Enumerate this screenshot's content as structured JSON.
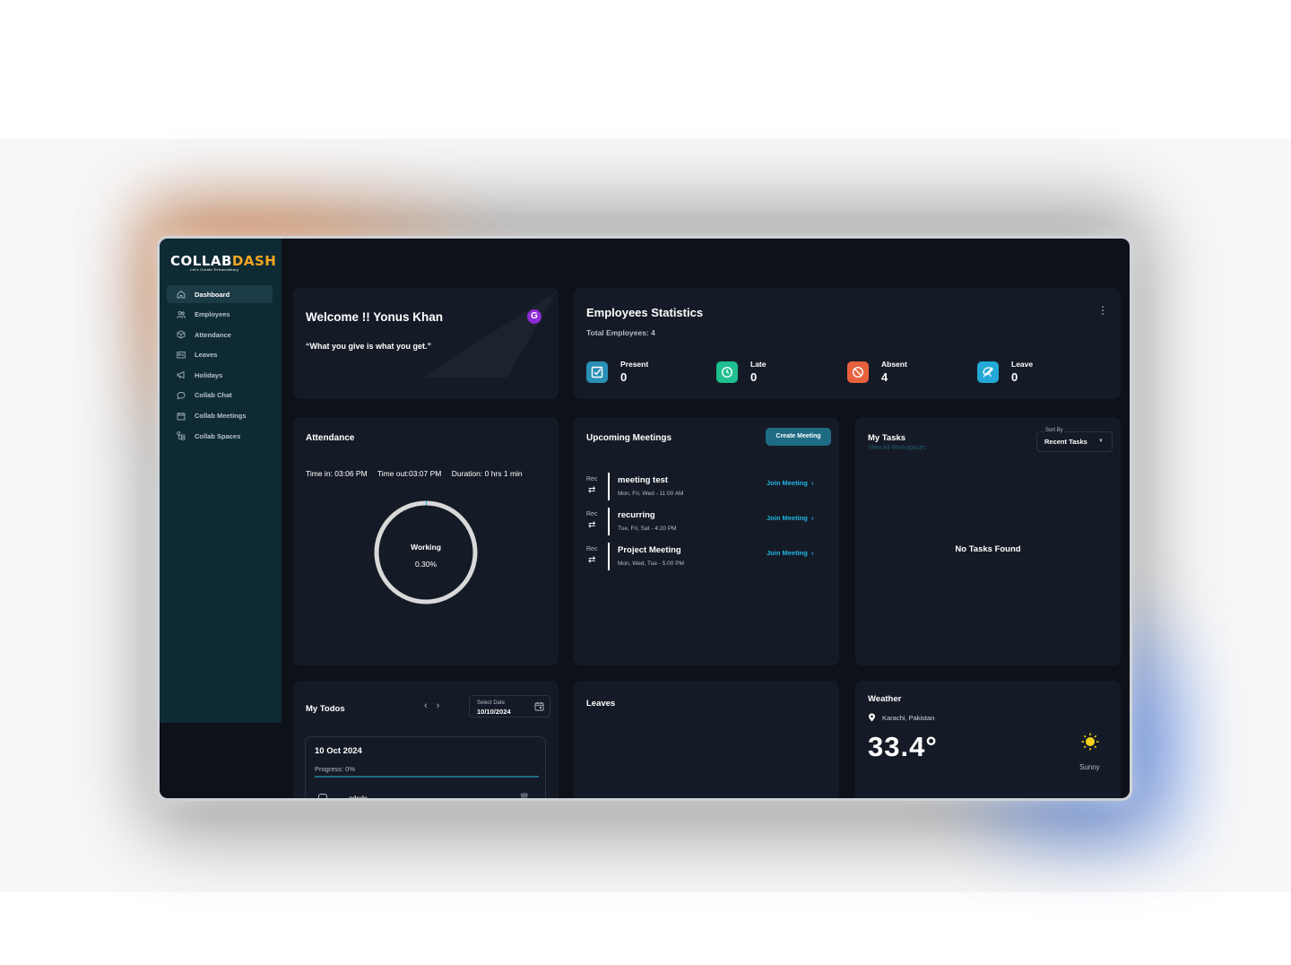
{
  "brand": {
    "name_part1": "COLLAB",
    "name_part2": "DASH",
    "tagline": "Let's Create Extraordinary",
    "accent_color": "#f5a623"
  },
  "sidebar": {
    "items": [
      {
        "label": "Dashboard",
        "icon": "home-icon",
        "active": true
      },
      {
        "label": "Employees",
        "icon": "users-icon"
      },
      {
        "label": "Attendance",
        "icon": "cube-icon"
      },
      {
        "label": "Leaves",
        "icon": "id-card-icon"
      },
      {
        "label": "Holidays",
        "icon": "megaphone-icon"
      },
      {
        "label": "Collab Chat",
        "icon": "chat-bubble-icon"
      },
      {
        "label": "Collab Meetings",
        "icon": "calendar-icon"
      },
      {
        "label": "Collab Spaces",
        "icon": "hierarchy-icon"
      }
    ]
  },
  "welcome": {
    "heading": "Welcome !! Yonus Khan",
    "quote": "“What you give is what you get.”",
    "badge_letter": "G"
  },
  "stats": {
    "heading": "Employees Statistics",
    "total": "Total Employees: 4",
    "items": [
      {
        "label": "Present",
        "value": "0",
        "color": "#2a8fb5",
        "icon": "checkbox-icon"
      },
      {
        "label": "Late",
        "value": "0",
        "color": "#1fbf8f",
        "icon": "clock-icon"
      },
      {
        "label": "Absent",
        "value": "4",
        "color": "#e8603c",
        "icon": "ban-icon"
      },
      {
        "label": "Leave",
        "value": "0",
        "color": "#22a9d6",
        "icon": "umbrella-off-icon"
      }
    ]
  },
  "attendance": {
    "heading": "Attendance",
    "time_in": "Time in: 03:06 PM",
    "time_out": "Time out:03:07 PM",
    "duration": "Duration: 0 hrs 1 min",
    "status": "Working",
    "percent": "0.30%",
    "progress_fraction": 0.003
  },
  "meetings": {
    "heading": "Upcoming Meetings",
    "create_label": "Create Meeting",
    "items": [
      {
        "rec": "Rec",
        "name": "meeting test",
        "days": "Mon, Fri, Wed - 11:00 AM",
        "join": "Join Meeting"
      },
      {
        "rec": "Rec",
        "name": "recurring",
        "days": "Tue, Fri, Sat - 4:20 PM",
        "join": "Join Meeting"
      },
      {
        "rec": "Rec",
        "name": "Project Meeting",
        "days": "Mon, Wed, Tue - 5:00 PM",
        "join": "Join Meeting"
      }
    ]
  },
  "tasks": {
    "heading": "My Tasks",
    "view_all": "View All Workspaces",
    "sort_label": "Sort By",
    "sort_value": "Recent Tasks",
    "empty": "No Tasks Found"
  },
  "todos": {
    "heading": "My Todos",
    "date_label": "Select Date",
    "date_value": "10/10/2024",
    "card_date": "10 Oct 2024",
    "progress": "Progress: 0%",
    "item": "cdcdc"
  },
  "leaves": {
    "heading": "Leaves"
  },
  "weather": {
    "heading": "Weather",
    "location": "Karachi, Pakistan",
    "temperature": "33.4°",
    "condition": "Sunny"
  }
}
